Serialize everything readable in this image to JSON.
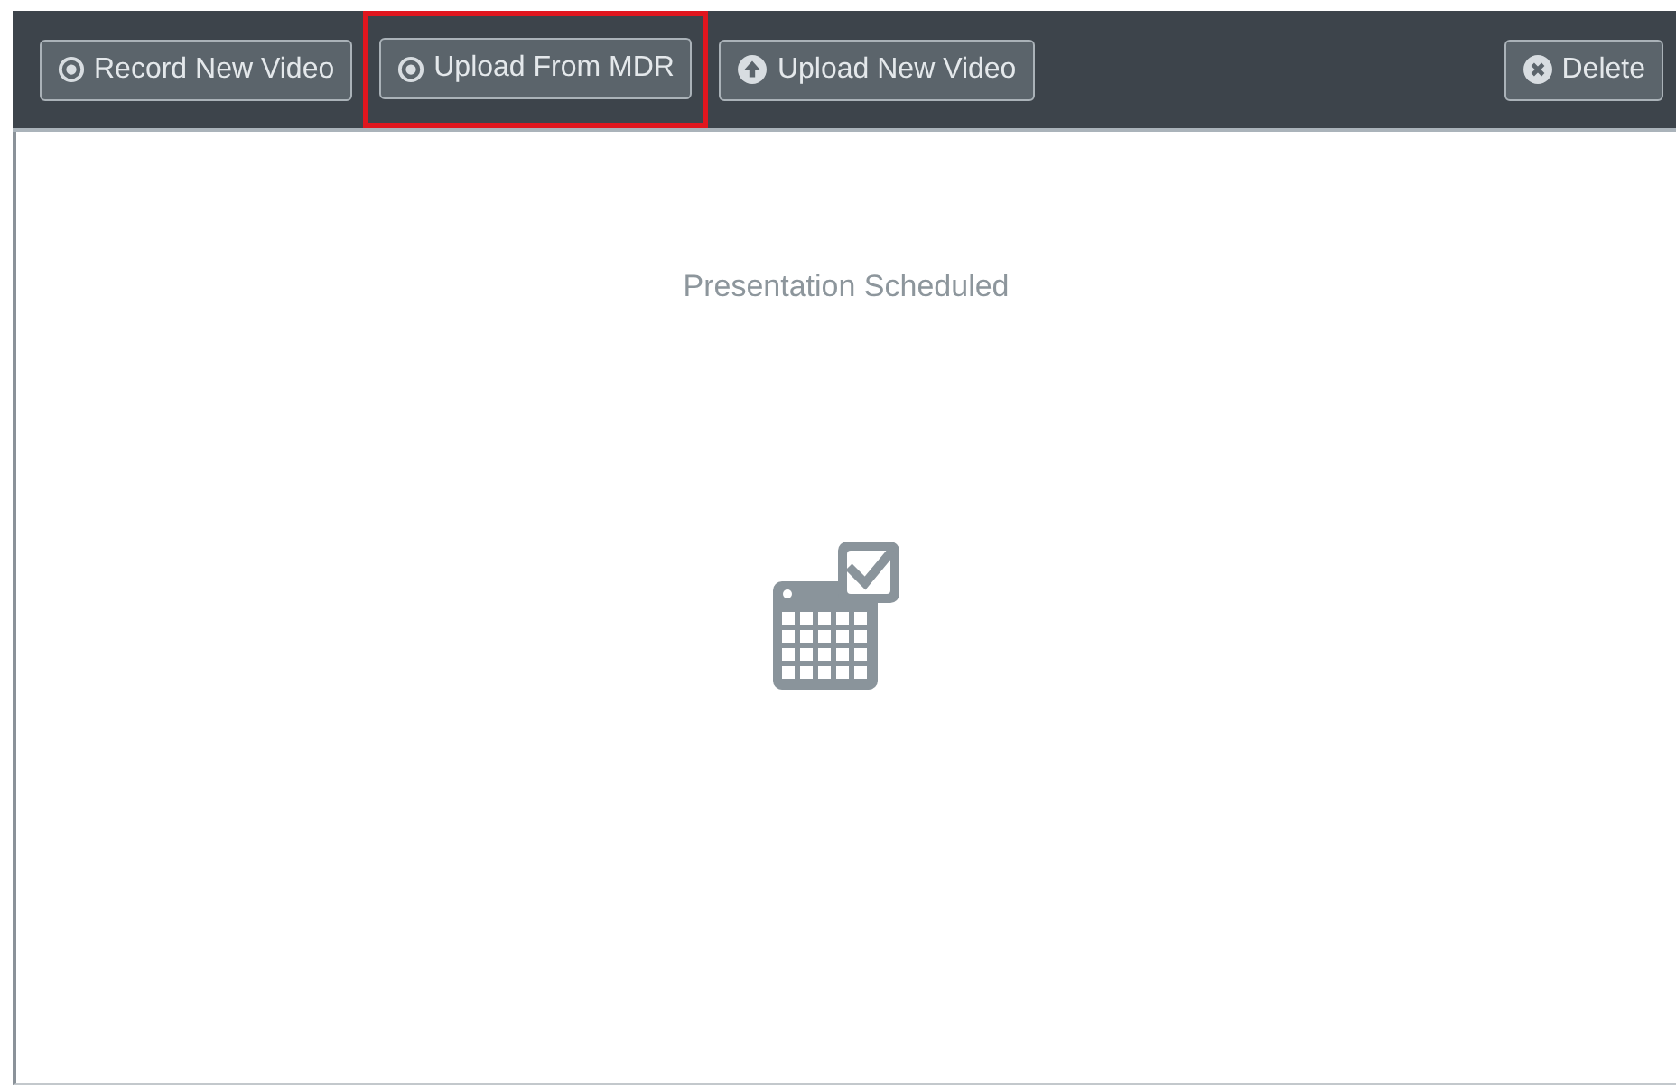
{
  "toolbar": {
    "buttons": [
      {
        "label": "Record New Video",
        "kind": "dot",
        "highlighted": false
      },
      {
        "label": "Upload From MDR",
        "kind": "dot",
        "highlighted": true
      },
      {
        "label": "Upload New Video",
        "kind": "upload",
        "highlighted": false
      }
    ],
    "right_button": {
      "label": "Delete",
      "kind": "close",
      "highlighted": false
    }
  },
  "content": {
    "message": "Presentation Scheduled"
  }
}
